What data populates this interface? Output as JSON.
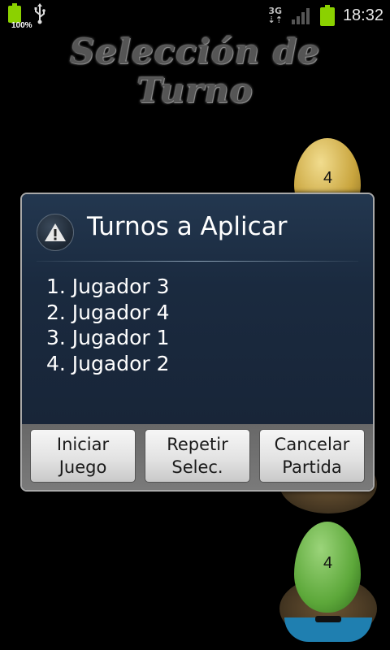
{
  "status_bar": {
    "battery_percent": "100%",
    "network_type": "3G",
    "time": "18:32"
  },
  "screen": {
    "title": "Selección de Turno",
    "title_line1": "Selección de",
    "title_line2": "Turno",
    "egg_numbers": [
      "4",
      "4"
    ]
  },
  "dialog": {
    "title": "Turnos a Aplicar",
    "icon": "warning-icon",
    "turns": [
      "1. Jugador 3",
      "2. Jugador 4",
      "3. Jugador 1",
      "4. Jugador 2"
    ],
    "buttons": {
      "start": "Iniciar\nJuego",
      "repeat": "Repetir\nSelec.",
      "cancel": "Cancelar\nPartida"
    }
  },
  "colors": {
    "dialog_bg": "#1c2c40",
    "battery_green": "#8bd100",
    "button_bar": "#707070"
  }
}
